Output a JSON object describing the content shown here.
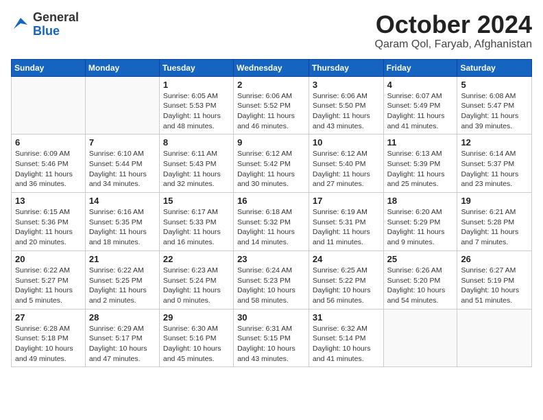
{
  "header": {
    "logo_line1": "General",
    "logo_line2": "Blue",
    "month": "October 2024",
    "location": "Qaram Qol, Faryab, Afghanistan"
  },
  "weekdays": [
    "Sunday",
    "Monday",
    "Tuesday",
    "Wednesday",
    "Thursday",
    "Friday",
    "Saturday"
  ],
  "weeks": [
    [
      {
        "day": "",
        "info": ""
      },
      {
        "day": "",
        "info": ""
      },
      {
        "day": "1",
        "info": "Sunrise: 6:05 AM\nSunset: 5:53 PM\nDaylight: 11 hours and 48 minutes."
      },
      {
        "day": "2",
        "info": "Sunrise: 6:06 AM\nSunset: 5:52 PM\nDaylight: 11 hours and 46 minutes."
      },
      {
        "day": "3",
        "info": "Sunrise: 6:06 AM\nSunset: 5:50 PM\nDaylight: 11 hours and 43 minutes."
      },
      {
        "day": "4",
        "info": "Sunrise: 6:07 AM\nSunset: 5:49 PM\nDaylight: 11 hours and 41 minutes."
      },
      {
        "day": "5",
        "info": "Sunrise: 6:08 AM\nSunset: 5:47 PM\nDaylight: 11 hours and 39 minutes."
      }
    ],
    [
      {
        "day": "6",
        "info": "Sunrise: 6:09 AM\nSunset: 5:46 PM\nDaylight: 11 hours and 36 minutes."
      },
      {
        "day": "7",
        "info": "Sunrise: 6:10 AM\nSunset: 5:44 PM\nDaylight: 11 hours and 34 minutes."
      },
      {
        "day": "8",
        "info": "Sunrise: 6:11 AM\nSunset: 5:43 PM\nDaylight: 11 hours and 32 minutes."
      },
      {
        "day": "9",
        "info": "Sunrise: 6:12 AM\nSunset: 5:42 PM\nDaylight: 11 hours and 30 minutes."
      },
      {
        "day": "10",
        "info": "Sunrise: 6:12 AM\nSunset: 5:40 PM\nDaylight: 11 hours and 27 minutes."
      },
      {
        "day": "11",
        "info": "Sunrise: 6:13 AM\nSunset: 5:39 PM\nDaylight: 11 hours and 25 minutes."
      },
      {
        "day": "12",
        "info": "Sunrise: 6:14 AM\nSunset: 5:37 PM\nDaylight: 11 hours and 23 minutes."
      }
    ],
    [
      {
        "day": "13",
        "info": "Sunrise: 6:15 AM\nSunset: 5:36 PM\nDaylight: 11 hours and 20 minutes."
      },
      {
        "day": "14",
        "info": "Sunrise: 6:16 AM\nSunset: 5:35 PM\nDaylight: 11 hours and 18 minutes."
      },
      {
        "day": "15",
        "info": "Sunrise: 6:17 AM\nSunset: 5:33 PM\nDaylight: 11 hours and 16 minutes."
      },
      {
        "day": "16",
        "info": "Sunrise: 6:18 AM\nSunset: 5:32 PM\nDaylight: 11 hours and 14 minutes."
      },
      {
        "day": "17",
        "info": "Sunrise: 6:19 AM\nSunset: 5:31 PM\nDaylight: 11 hours and 11 minutes."
      },
      {
        "day": "18",
        "info": "Sunrise: 6:20 AM\nSunset: 5:29 PM\nDaylight: 11 hours and 9 minutes."
      },
      {
        "day": "19",
        "info": "Sunrise: 6:21 AM\nSunset: 5:28 PM\nDaylight: 11 hours and 7 minutes."
      }
    ],
    [
      {
        "day": "20",
        "info": "Sunrise: 6:22 AM\nSunset: 5:27 PM\nDaylight: 11 hours and 5 minutes."
      },
      {
        "day": "21",
        "info": "Sunrise: 6:22 AM\nSunset: 5:25 PM\nDaylight: 11 hours and 2 minutes."
      },
      {
        "day": "22",
        "info": "Sunrise: 6:23 AM\nSunset: 5:24 PM\nDaylight: 11 hours and 0 minutes."
      },
      {
        "day": "23",
        "info": "Sunrise: 6:24 AM\nSunset: 5:23 PM\nDaylight: 10 hours and 58 minutes."
      },
      {
        "day": "24",
        "info": "Sunrise: 6:25 AM\nSunset: 5:22 PM\nDaylight: 10 hours and 56 minutes."
      },
      {
        "day": "25",
        "info": "Sunrise: 6:26 AM\nSunset: 5:20 PM\nDaylight: 10 hours and 54 minutes."
      },
      {
        "day": "26",
        "info": "Sunrise: 6:27 AM\nSunset: 5:19 PM\nDaylight: 10 hours and 51 minutes."
      }
    ],
    [
      {
        "day": "27",
        "info": "Sunrise: 6:28 AM\nSunset: 5:18 PM\nDaylight: 10 hours and 49 minutes."
      },
      {
        "day": "28",
        "info": "Sunrise: 6:29 AM\nSunset: 5:17 PM\nDaylight: 10 hours and 47 minutes."
      },
      {
        "day": "29",
        "info": "Sunrise: 6:30 AM\nSunset: 5:16 PM\nDaylight: 10 hours and 45 minutes."
      },
      {
        "day": "30",
        "info": "Sunrise: 6:31 AM\nSunset: 5:15 PM\nDaylight: 10 hours and 43 minutes."
      },
      {
        "day": "31",
        "info": "Sunrise: 6:32 AM\nSunset: 5:14 PM\nDaylight: 10 hours and 41 minutes."
      },
      {
        "day": "",
        "info": ""
      },
      {
        "day": "",
        "info": ""
      }
    ]
  ]
}
